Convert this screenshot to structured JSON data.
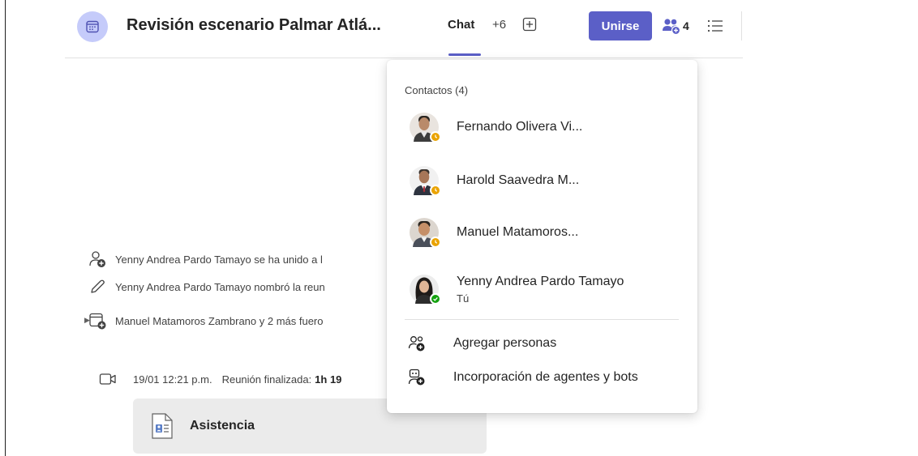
{
  "header": {
    "title": "Revisión escenario Palmar Atlá...",
    "tab_chat": "Chat",
    "tab_more": "+6",
    "join_label": "Unirse",
    "participant_count": "4"
  },
  "feed": {
    "events": [
      {
        "icon": "person-add-icon",
        "text": "Yenny Andrea Pardo Tamayo se ha unido a l"
      },
      {
        "icon": "pencil-icon",
        "text": "Yenny Andrea Pardo Tamayo nombró la reun"
      },
      {
        "icon": "calendar-add-icon",
        "text": "Manuel Matamoros Zambrano y 2 más fuero"
      }
    ],
    "meeting": {
      "time": "19/01 12:21 p.m.",
      "label": "Reunión finalizada:",
      "duration": "1h 19"
    },
    "attendance_card": "Asistencia"
  },
  "popup": {
    "title": "Contactos (4)",
    "contacts": [
      {
        "name": "Fernando Olivera Vi...",
        "status": "away",
        "subtitle": ""
      },
      {
        "name": "Harold Saavedra M...",
        "status": "away",
        "subtitle": ""
      },
      {
        "name": "Manuel Matamoros...",
        "status": "away",
        "subtitle": ""
      },
      {
        "name": "Yenny Andrea Pardo Tamayo",
        "status": "available",
        "subtitle": "Tú"
      }
    ],
    "actions": [
      {
        "icon": "person-add-icon",
        "label": "Agregar personas"
      },
      {
        "icon": "bot-add-icon",
        "label": "Incorporación de agentes y bots"
      }
    ]
  },
  "colors": {
    "accent": "#5b5fc7",
    "meeting_icon_bg": "#c5cbfa",
    "presence_away": "#eaa300",
    "presence_available": "#13a10e"
  }
}
